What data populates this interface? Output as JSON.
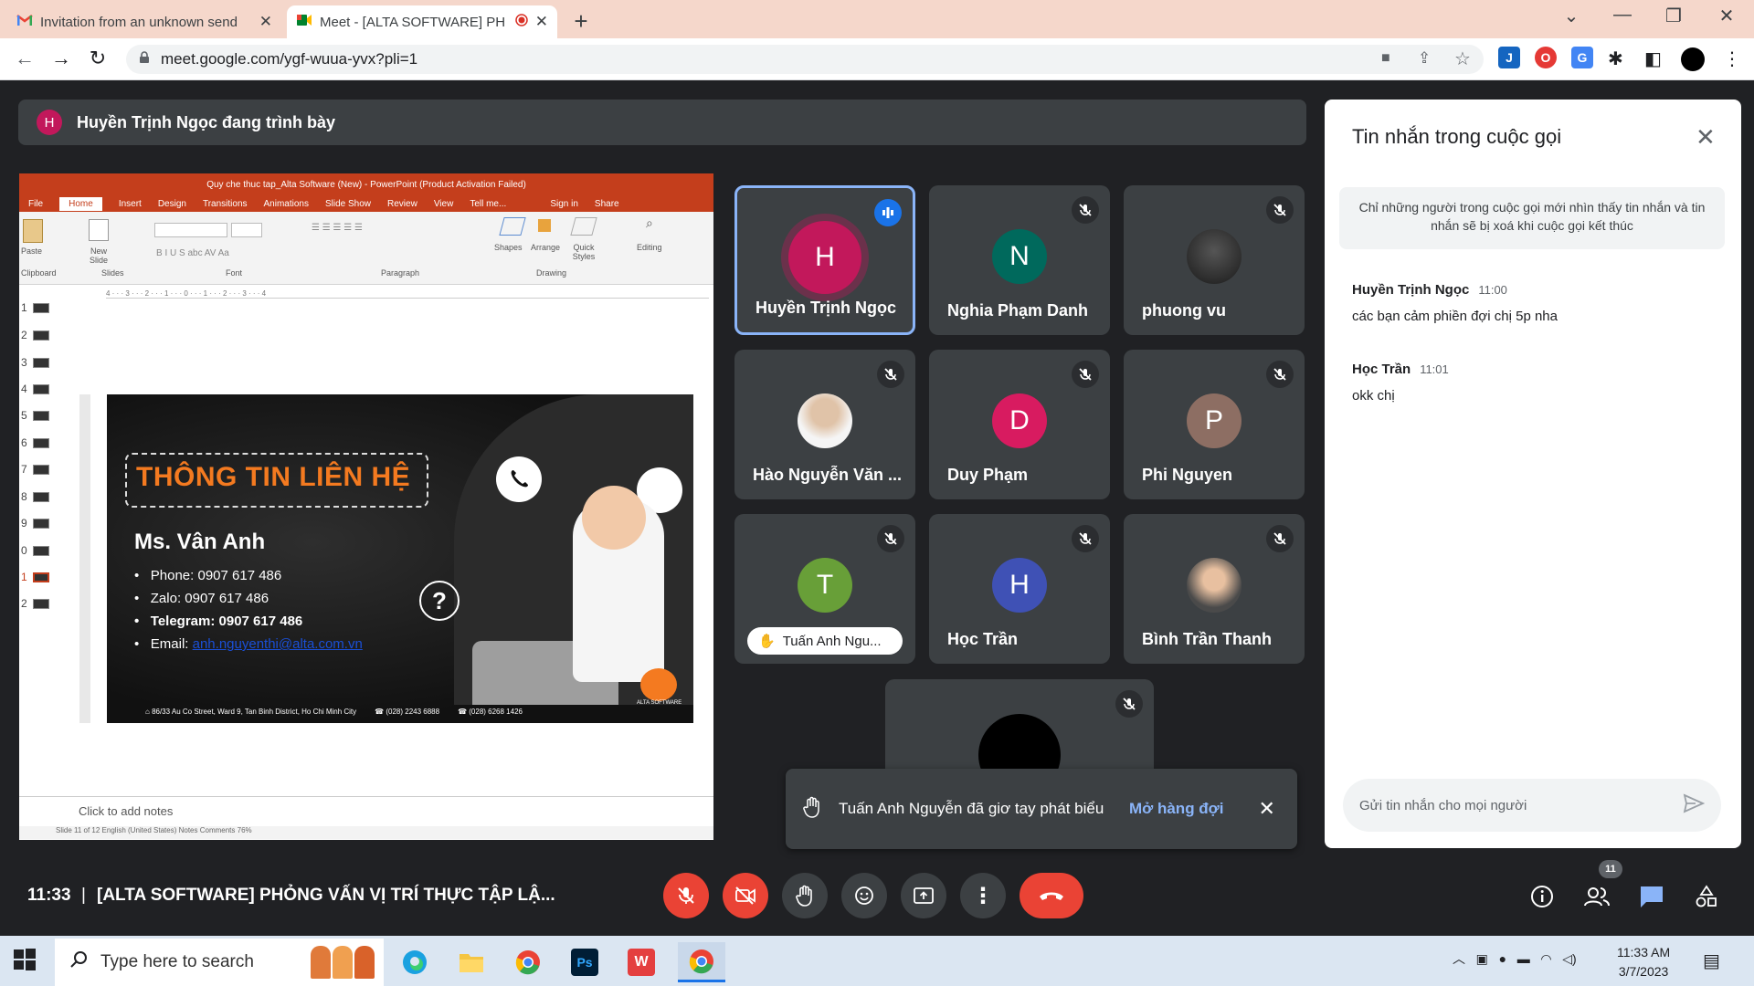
{
  "browser": {
    "tabs": [
      {
        "title": "Invitation from an unknown send",
        "icon": "gmail-icon",
        "active": false
      },
      {
        "title": "Meet - [ALTA SOFTWARE] PH",
        "icon": "meet-icon",
        "active": true
      }
    ],
    "url": "meet.google.com/ygf-wuua-yvx?pli=1",
    "new_tab": "+"
  },
  "presenter_banner": {
    "initial": "H",
    "text": "Huyền Trịnh Ngọc đang trình bày"
  },
  "powerpoint": {
    "title": "Quy che thuc tap_Alta Software (New) - PowerPoint (Product Activation Failed)",
    "tabs": [
      "File",
      "Home",
      "Insert",
      "Design",
      "Transitions",
      "Animations",
      "Slide Show",
      "Review",
      "View",
      "Tell me...",
      "Sign in",
      "Share"
    ],
    "groups": [
      "Clipboard",
      "Slides",
      "Font",
      "Paragraph",
      "Drawing",
      "Editing"
    ],
    "ribbon_buttons": [
      "Paste",
      "New Slide",
      "Shapes",
      "Arrange",
      "Quick Styles",
      "Editing"
    ],
    "ruler": "4 · · · 3 · · · 2 · · · 1 · · · 0 · · · 1 · · · 2 · · · 3 · · · 4",
    "slide_numbers": [
      "1",
      "2",
      "3",
      "4",
      "5",
      "6",
      "7",
      "8",
      "9",
      "0",
      "1",
      "2"
    ],
    "slide": {
      "heading": "THÔNG TIN LIÊN HỆ",
      "name": "Ms. Vân Anh",
      "lines": [
        "Phone: 0907 617 486",
        "Zalo: 0907 617 486",
        "Telegram: 0907 617 486",
        "Email:"
      ],
      "email": "anh.nguyenthi@alta.com.vn",
      "footer": [
        "86/33 Au Co Street, Ward 9, Tan Binh District, Ho Chi Minh City",
        "(028) 2243 6888",
        "(028) 6268 1426"
      ],
      "logo_caption": "ALTA SOFTWARE"
    },
    "notes": "Click to add notes",
    "status": "Slide 11 of 12     English (United States)          Notes   Comments          76%"
  },
  "participants": [
    {
      "name": "Huyền Trịnh Ngọc",
      "initial": "H",
      "color": "#c2185b",
      "speaking": true
    },
    {
      "name": "Nghia Phạm Danh",
      "initial": "N",
      "color": "#00695c",
      "muted": true
    },
    {
      "name": "phuong vu",
      "initial": "",
      "photo": "photo-avatar-icon",
      "muted": true
    },
    {
      "name": "Hào Nguyễn Văn ...",
      "initial": "",
      "photo": "photo-avatar-icon",
      "muted": true
    },
    {
      "name": "Duy Phạm",
      "initial": "D",
      "color": "#d81b60",
      "muted": true
    },
    {
      "name": "Phi Nguyen",
      "initial": "P",
      "color": "#8d6e63",
      "muted": true
    },
    {
      "name": "Tuấn Anh Ngu...",
      "initial": "T",
      "color": "#689f38",
      "muted": true,
      "hand_raised": true
    },
    {
      "name": "Học Trần",
      "initial": "H",
      "color": "#3f51b5",
      "muted": true
    },
    {
      "name": "Bình Trần Thanh",
      "initial": "",
      "photo": "photo-avatar-icon",
      "muted": true
    },
    {
      "name": "",
      "initial": "",
      "color": "#000000",
      "muted": true
    }
  ],
  "toast": {
    "message": "Tuấn Anh Nguyễn đã giơ tay phát biểu",
    "action": "Mở hàng đợi"
  },
  "chat": {
    "title": "Tin nhắn trong cuộc gọi",
    "notice": "Chỉ những người trong cuộc gọi mới nhìn thấy tin nhắn và tin nhắn sẽ bị xoá khi cuộc gọi kết thúc",
    "messages": [
      {
        "sender": "Huyền Trịnh Ngọc",
        "time": "11:00",
        "text": "các bạn cảm phiền đợi chị 5p nha"
      },
      {
        "sender": "Học Trần",
        "time": "11:01",
        "text": "okk chị"
      }
    ],
    "input_placeholder": "Gửi tin nhắn cho mọi người"
  },
  "bottom_bar": {
    "time": "11:33",
    "separator": "|",
    "meeting_title": "[ALTA SOFTWARE] PHỎNG VẤN VỊ TRÍ THỰC TẬP LẬ...",
    "participant_count": "11"
  },
  "taskbar": {
    "search_placeholder": "Type here to search",
    "time": "11:33 AM",
    "date": "3/7/2023"
  },
  "colors": {
    "accent": "#8ab4f8",
    "end_call": "#ea4335",
    "tab_strip": "#f5d7cb",
    "meet_bg": "#202124"
  }
}
